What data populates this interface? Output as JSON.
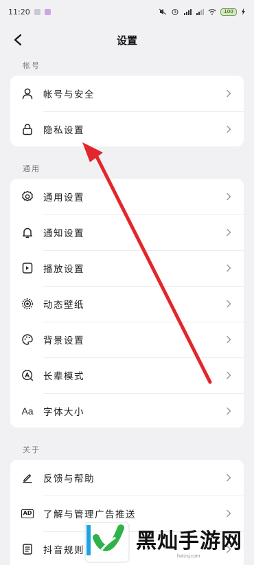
{
  "status_bar": {
    "time": "11:20",
    "battery": "100"
  },
  "header": {
    "title": "设置"
  },
  "sections": {
    "account": {
      "label": "帐号",
      "items": [
        {
          "label": "帐号与安全",
          "icon": "user-icon"
        },
        {
          "label": "隐私设置",
          "icon": "lock-icon"
        }
      ]
    },
    "general": {
      "label": "通用",
      "items": [
        {
          "label": "通用设置",
          "icon": "gear-icon"
        },
        {
          "label": "通知设置",
          "icon": "bell-icon"
        },
        {
          "label": "播放设置",
          "icon": "play-settings-icon"
        },
        {
          "label": "动态壁纸",
          "icon": "live-wallpaper-icon"
        },
        {
          "label": "背景设置",
          "icon": "palette-icon"
        },
        {
          "label": "长辈模式",
          "icon": "elder-mode-icon"
        },
        {
          "label": "字体大小",
          "icon": "font-size-icon",
          "glyph": "Aa"
        }
      ]
    },
    "about": {
      "label": "关于",
      "items": [
        {
          "label": "反馈与帮助",
          "icon": "edit-icon"
        },
        {
          "label": "了解与管理广告推送",
          "icon": "ad-icon",
          "glyph": "AD"
        },
        {
          "label": "抖音规则",
          "icon": "rules-icon"
        }
      ]
    }
  },
  "watermark": {
    "text": "黑灿手游网",
    "url": "hutzsj.com"
  },
  "colors": {
    "background": "#f1f1f4",
    "card": "#ffffff",
    "annotation_arrow": "#e3262c"
  }
}
